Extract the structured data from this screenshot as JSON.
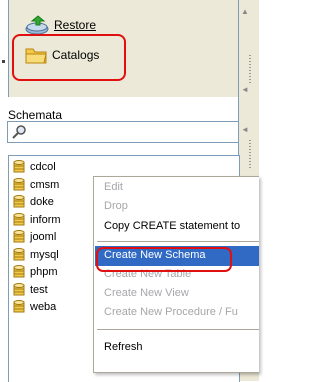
{
  "top_items": {
    "restore_label": "Restore",
    "catalogs_label": "Catalogs"
  },
  "schemata": {
    "label": "Schemata",
    "search_placeholder": ""
  },
  "databases": [
    "cdcol",
    "cmsm",
    "doke",
    "inform",
    "jooml",
    "mysql",
    "phpm",
    "test",
    "weba"
  ],
  "context_menu": {
    "items": [
      {
        "label": "Edit",
        "enabled": false
      },
      {
        "label": "Drop",
        "enabled": false
      },
      {
        "label": "Copy CREATE statement to",
        "enabled": true
      },
      {
        "label": "Create New Schema",
        "enabled": true,
        "highlighted": true
      },
      {
        "label": "Create New Table",
        "enabled": false
      },
      {
        "label": "Create New View",
        "enabled": false
      },
      {
        "label": "Create New Procedure / Fu",
        "enabled": false
      },
      {
        "label": "Refresh",
        "enabled": true
      }
    ]
  },
  "colors": {
    "highlight": "#316ac5",
    "annotation_red": "#e01010",
    "db_icon": "#f2c94c"
  }
}
